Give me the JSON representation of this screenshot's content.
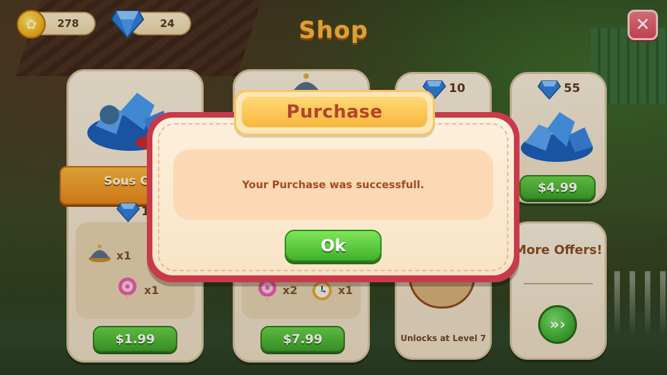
{
  "hud": {
    "coins": "278",
    "gems": "24",
    "title": "Shop",
    "close_icon": "x-icon"
  },
  "cards": [
    {
      "banner_label": "Sous C",
      "gem_value": "1",
      "items": [
        {
          "icon": "chef-bell-icon",
          "qty": "x1"
        },
        {
          "icon": "lollipop-icon",
          "qty": "x1"
        }
      ],
      "price": "$1.99"
    },
    {
      "items": [
        {
          "icon": "lollipop-icon",
          "qty": "x2"
        },
        {
          "icon": "clock-icon",
          "qty": "x1"
        }
      ],
      "price": "$7.99"
    },
    {
      "gem_value": "10",
      "unlock_text": "Unlocks at Level 7"
    },
    {
      "gem_value": "55",
      "price": "$4.99"
    }
  ],
  "more_offers": {
    "label": "More Offers!",
    "button_icon": "triple-chevron-right-icon"
  },
  "dialog": {
    "title": "Purchase",
    "message": "Your Purchase was successfull.",
    "ok_label": "Ok"
  },
  "colors": {
    "dialog_border": "#c83a4a",
    "button_green": "#3fb22b",
    "title_orange": "#f9b93a"
  }
}
